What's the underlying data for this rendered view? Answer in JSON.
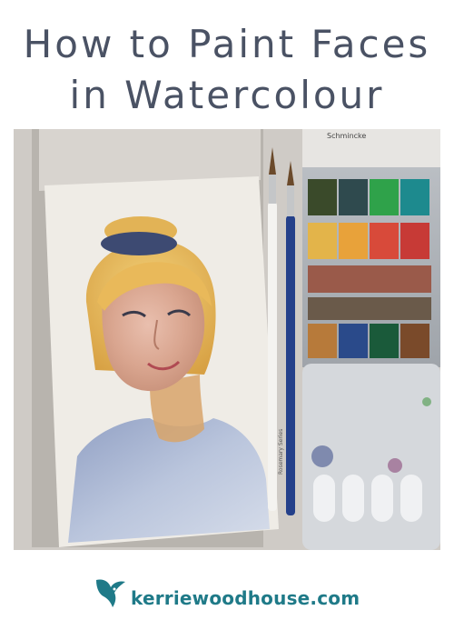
{
  "header": {
    "title_line1": "How to Paint Faces",
    "title_line2": "in Watercolour"
  },
  "photo": {
    "palette_brand_label": "Schmincke",
    "brush_label": "Rosemary Series"
  },
  "footer": {
    "website": "kerriewoodhouse.com",
    "logo_icon": "hummingbird-icon"
  },
  "colors": {
    "title_text": "#4a5264",
    "footer_text": "#1f7a88",
    "background": "#ffffff"
  }
}
